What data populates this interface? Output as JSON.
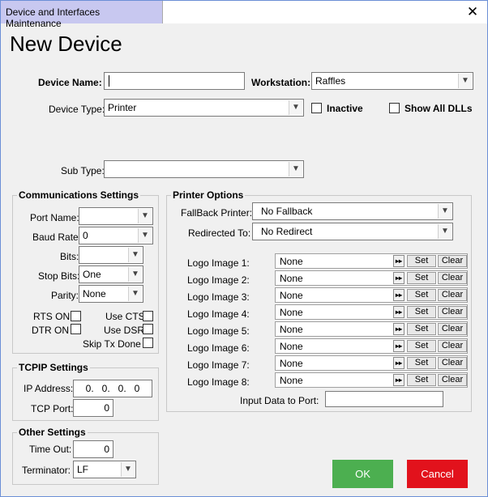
{
  "window": {
    "title": "Device and Interfaces Maintenance",
    "close": "✕"
  },
  "page": {
    "heading": "New Device"
  },
  "device": {
    "name_label": "Device Name:",
    "name_value": "",
    "workstation_label": "Workstation:",
    "workstation_value": "Raffles",
    "type_label": "Device Type:",
    "type_value": "Printer",
    "inactive_label": "Inactive",
    "show_all_dlls_label": "Show All DLLs",
    "subtype_label": "Sub Type:",
    "subtype_value": ""
  },
  "comm": {
    "title": "Communications Settings",
    "port_name_label": "Port Name:",
    "port_name_value": "",
    "baud_rate_label": "Baud Rate:",
    "baud_rate_value": "0",
    "bits_label": "Bits:",
    "bits_value": "",
    "stop_bits_label": "Stop Bits:",
    "stop_bits_value": "One",
    "parity_label": "Parity:",
    "parity_value": "None",
    "rts_on": "RTS ON",
    "use_cts": "Use CTS",
    "dtr_on": "DTR ON",
    "use_dsr": "Use DSR",
    "skip_tx_done": "Skip Tx Done"
  },
  "tcpip": {
    "title": "TCPIP Settings",
    "ip_label": "IP Address:",
    "ip_value": "0.   0.   0.   0",
    "port_label": "TCP Port:",
    "port_value": "0"
  },
  "other": {
    "title": "Other Settings",
    "timeout_label": "Time Out:",
    "timeout_value": "0",
    "terminator_label": "Terminator:",
    "terminator_value": "LF"
  },
  "printer": {
    "title": "Printer Options",
    "fallback_label": "FallBack Printer:",
    "fallback_value": "No Fallback",
    "redirected_label": "Redirected To:",
    "redirected_value": "No Redirect",
    "logo_images": [
      {
        "label": "Logo Image 1:",
        "value": "None"
      },
      {
        "label": "Logo Image 2:",
        "value": "None"
      },
      {
        "label": "Logo Image 3:",
        "value": "None"
      },
      {
        "label": "Logo Image 4:",
        "value": "None"
      },
      {
        "label": "Logo Image 5:",
        "value": "None"
      },
      {
        "label": "Logo Image 6:",
        "value": "None"
      },
      {
        "label": "Logo Image 7:",
        "value": "None"
      },
      {
        "label": "Logo Image 8:",
        "value": "None"
      }
    ],
    "go_glyph": "▸▸",
    "set_label": "Set",
    "clear_label": "Clear",
    "input_data_label": "Input Data to Port:",
    "input_data_value": ""
  },
  "buttons": {
    "ok": "OK",
    "cancel": "Cancel"
  },
  "colors": {
    "ok": "#4caf50",
    "cancel": "#e2121c",
    "title_tab": "#c8c8f0"
  },
  "icons": {
    "dropdown": "chevron-down-icon",
    "close": "close-icon"
  }
}
